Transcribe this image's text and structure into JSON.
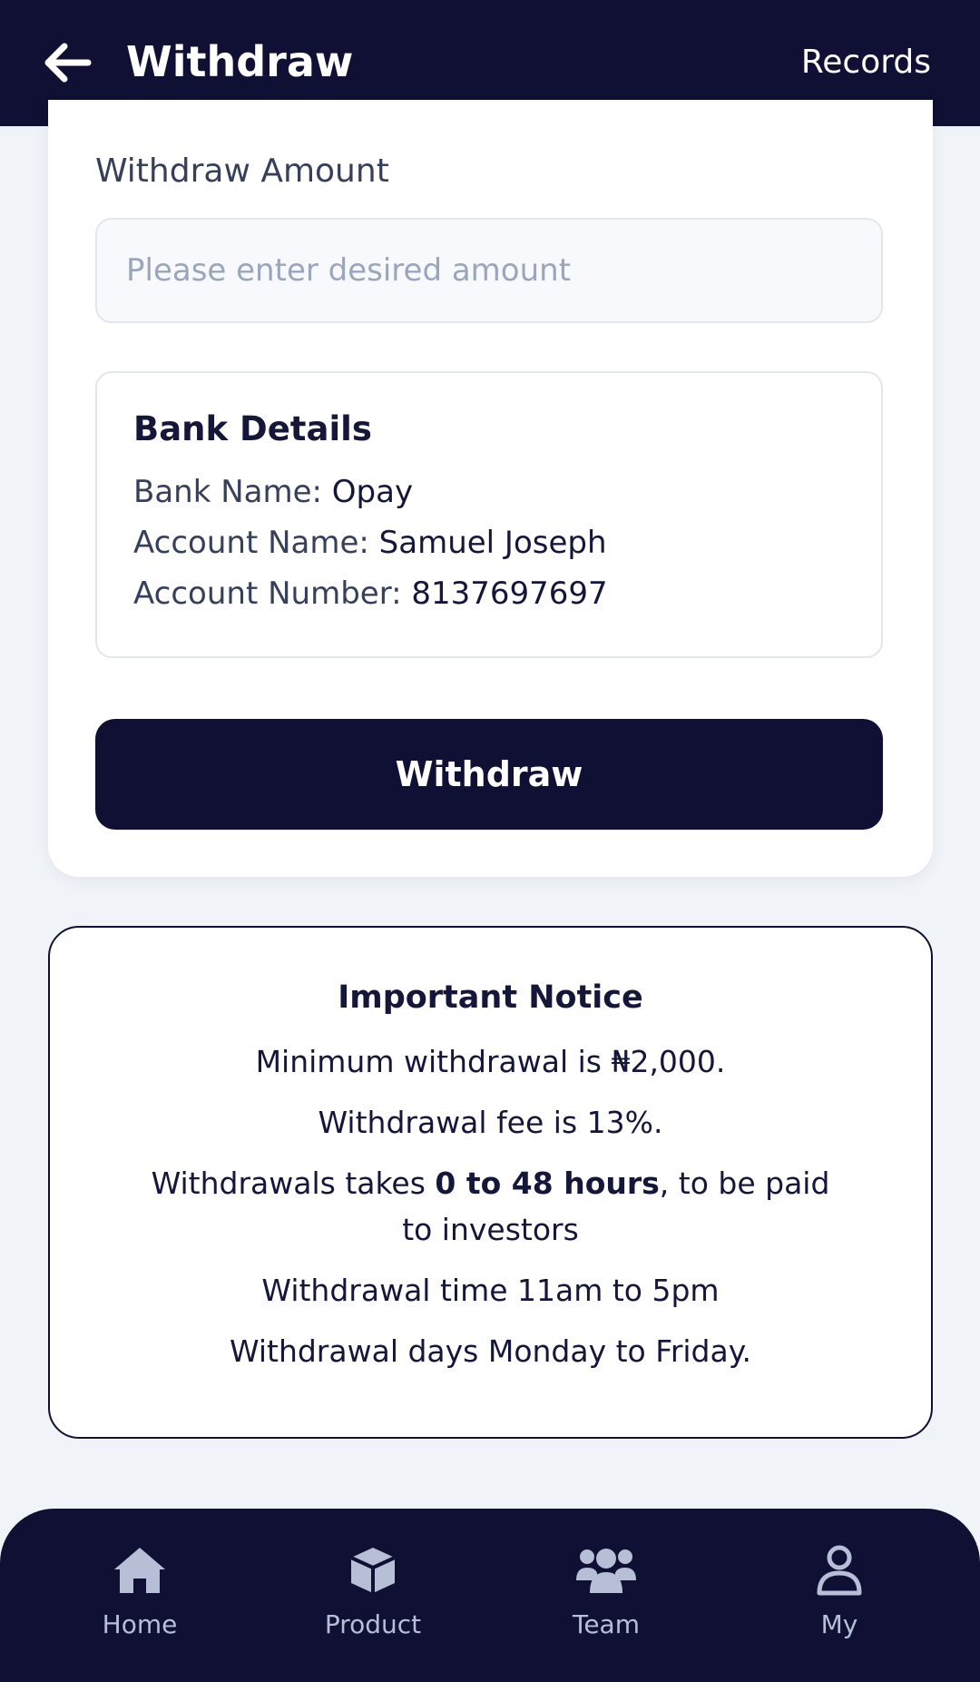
{
  "header": {
    "title": "Withdraw",
    "records_label": "Records",
    "back_icon": "arrow-left-icon"
  },
  "form": {
    "amount_label": "Withdraw Amount",
    "amount_placeholder": "Please enter desired amount",
    "amount_value": ""
  },
  "bank": {
    "title": "Bank Details",
    "bank_name_label": "Bank Name: ",
    "bank_name_value": "Opay",
    "account_name_label": "Account Name: ",
    "account_name_value": "Samuel Joseph",
    "account_number_label": "Account Number: ",
    "account_number_value": "8137697697"
  },
  "withdraw_button_label": "Withdraw",
  "notice": {
    "title": "Important Notice",
    "min_withdrawal": "Minimum withdrawal is ₦2,000.",
    "fee": "Withdrawal fee is 13%.",
    "duration_prefix": "Withdrawals takes ",
    "duration_bold": "0 to 48 hours",
    "duration_suffix": ", to be paid to investors",
    "time": "Withdrawal time 11am to 5pm",
    "days": "Withdrawal days Monday to Friday."
  },
  "nav": {
    "items": [
      {
        "label": "Home",
        "icon": "home-icon"
      },
      {
        "label": "Product",
        "icon": "box-icon"
      },
      {
        "label": "Team",
        "icon": "team-icon"
      },
      {
        "label": "My",
        "icon": "user-icon"
      }
    ]
  },
  "colors": {
    "primary": "#101034",
    "background": "#f0f3f8",
    "nav_inactive": "#b7bfd6"
  }
}
